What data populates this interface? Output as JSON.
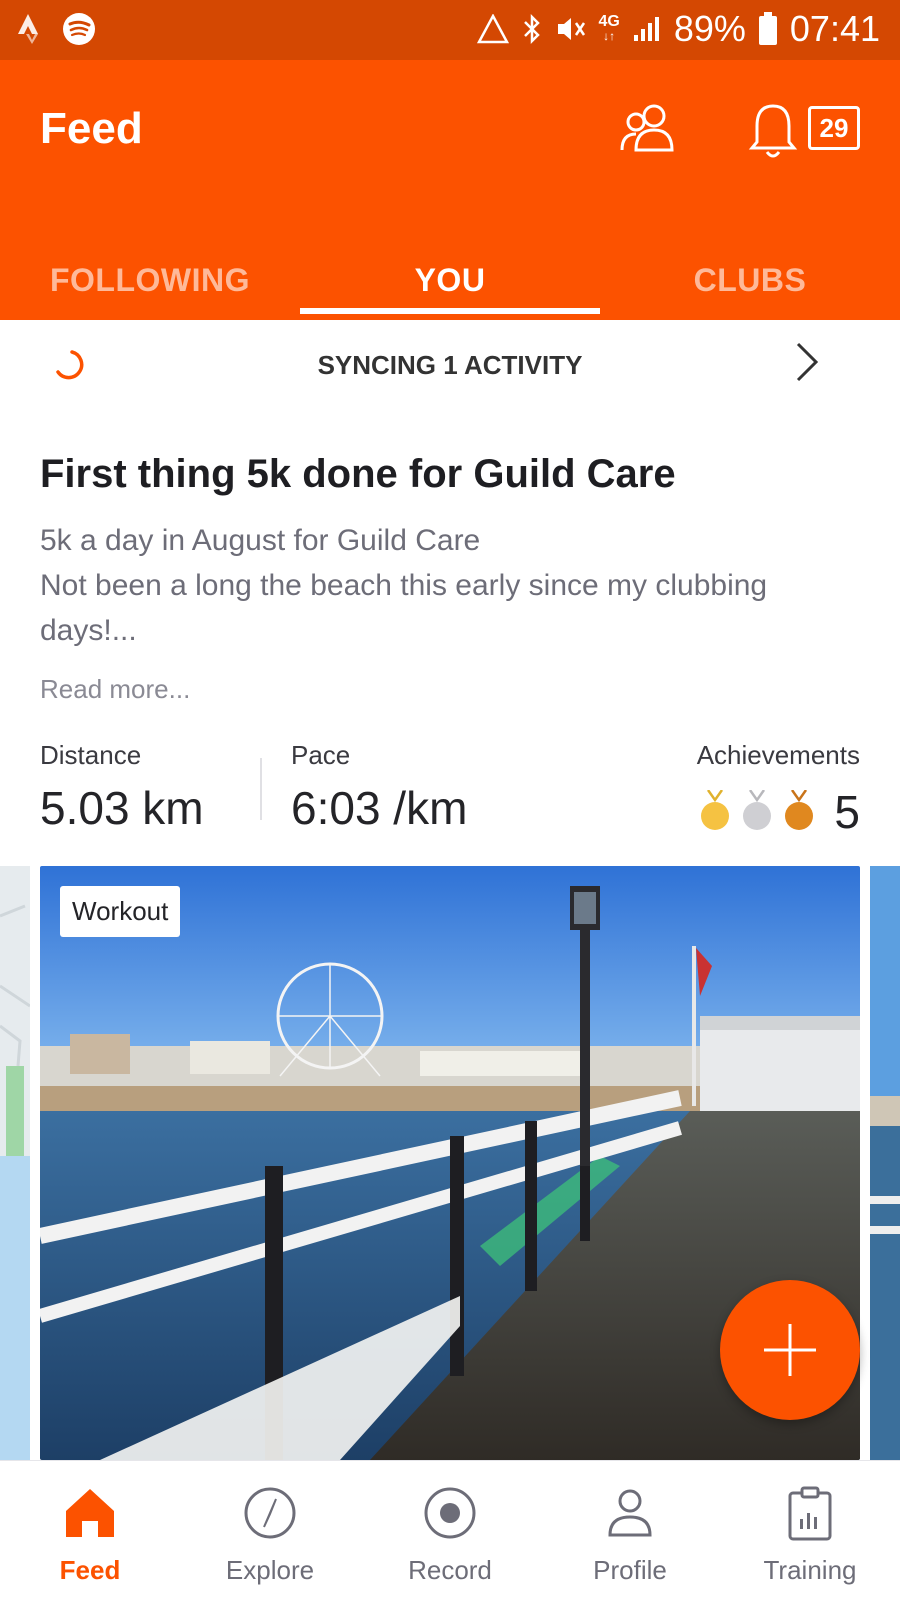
{
  "status_bar": {
    "battery": "89%",
    "time": "07:41",
    "network": "4G"
  },
  "header": {
    "title": "Feed",
    "notification_count": "29"
  },
  "tabs": [
    {
      "label": "FOLLOWING",
      "active": false
    },
    {
      "label": "YOU",
      "active": true
    },
    {
      "label": "CLUBS",
      "active": false
    }
  ],
  "sync": {
    "text": "SYNCING 1 ACTIVITY"
  },
  "activity": {
    "title": "First thing 5k done for Guild Care",
    "description_line1": "5k a day in August for Guild Care",
    "description_line2": "Not been a long the beach this early since my clubbing days!...",
    "read_more": "Read more...",
    "stats": {
      "distance_label": "Distance",
      "distance_value": "5.03 km",
      "pace_label": "Pace",
      "pace_value": "6:03 /km",
      "achievements_label": "Achievements",
      "achievements_count": "5"
    },
    "media_tag": "Workout"
  },
  "bottom_nav": [
    {
      "label": "Feed",
      "icon": "home-icon",
      "active": true
    },
    {
      "label": "Explore",
      "icon": "compass-icon",
      "active": false
    },
    {
      "label": "Record",
      "icon": "record-icon",
      "active": false
    },
    {
      "label": "Profile",
      "icon": "profile-icon",
      "active": false
    },
    {
      "label": "Training",
      "icon": "clipboard-chart-icon",
      "active": false
    }
  ],
  "colors": {
    "brand": "#fc5200",
    "status_bar": "#d44802",
    "gold": "#f5c242",
    "silver": "#cfcfd3",
    "bronze": "#e0881f"
  }
}
